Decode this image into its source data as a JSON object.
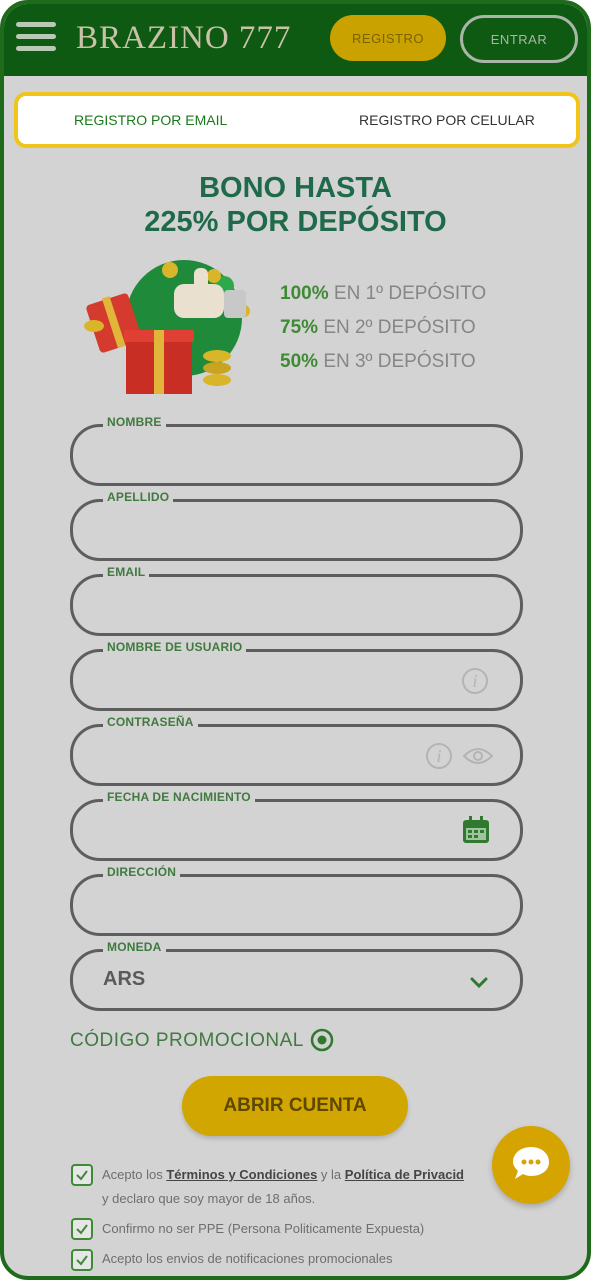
{
  "header": {
    "logo": "BRAZINO 777",
    "register_label": "REGISTRO",
    "login_label": "ENTRAR"
  },
  "tabs": [
    {
      "label": "REGISTRO POR EMAIL",
      "active": true
    },
    {
      "label": "REGISTRO POR CELULAR",
      "active": false
    }
  ],
  "promo": {
    "title_line1": "BONO HASTA",
    "title_line2": "225% POR DEPÓSITO",
    "bonuses": [
      {
        "percent": "100%",
        "text": "EN 1º DEPÓSITO"
      },
      {
        "percent": "75%",
        "text": "EN 2º DEPÓSITO"
      },
      {
        "percent": "50%",
        "text": "EN 3º DEPÓSITO"
      }
    ]
  },
  "form": {
    "nombre_label": "NOMBRE",
    "apellido_label": "APELLIDO",
    "email_label": "EMAIL",
    "usuario_label": "NOMBRE DE USUARIO",
    "password_label": "CONTRASEÑA",
    "birthdate_label": "FECHA DE NACIMIENTO",
    "address_label": "DIRECCIÓN",
    "currency_label": "MONEDA",
    "currency_value": "ARS",
    "promo_code_label": "CÓDIGO PROMOCIONAL",
    "submit_label": "ABRIR CUENTA"
  },
  "consents": {
    "terms_prefix": "Acepto los ",
    "terms_link": "Términos y Condiciones",
    "terms_mid": " y la ",
    "privacy_link": "Política de Privacid",
    "terms_line2": "y declaro que soy mayor de 18 años.",
    "ppe": "Confirmo no ser PPE (Persona Politicamente Expuesta)",
    "notifications": "Acepto los envios de notificaciones promocionales"
  },
  "colors": {
    "header_bg": "#0f5a12",
    "accent_yellow": "#d2a600",
    "accent_green": "#3f8a35",
    "tab_border": "#f0c419"
  },
  "icons": [
    "menu-icon",
    "info-icon",
    "eye-icon",
    "calendar-icon",
    "chevron-down-icon",
    "plus-circle-icon",
    "checkbox-icon",
    "chat-icon"
  ]
}
